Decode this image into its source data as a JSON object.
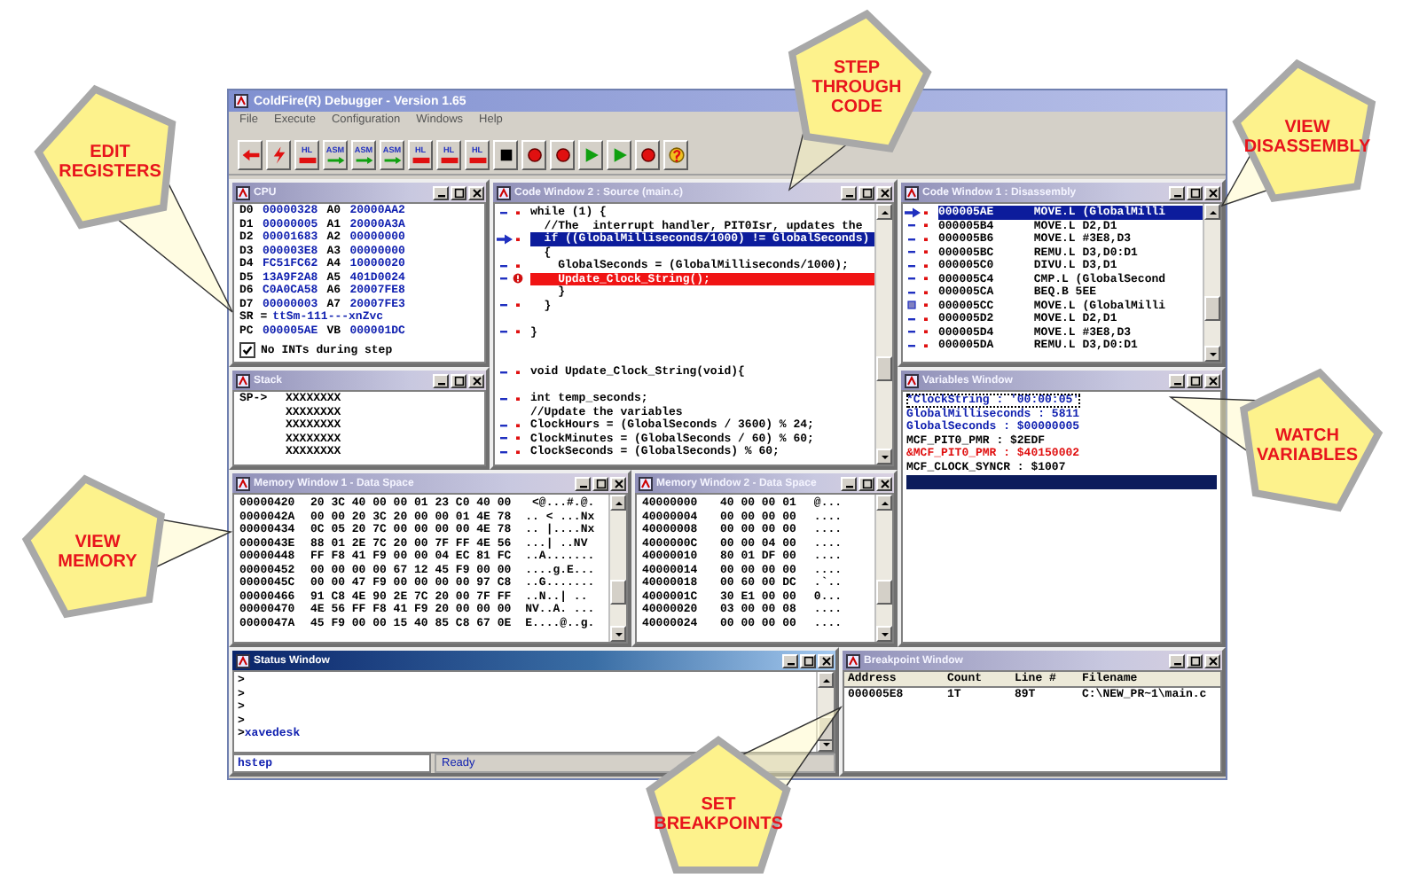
{
  "window": {
    "title": "ColdFire(R) Debugger - Version 1.65"
  },
  "menu": [
    "File",
    "Execute",
    "Configuration",
    "Windows",
    "Help"
  ],
  "toolbar": [
    {
      "kind": "back"
    },
    {
      "kind": "go"
    },
    {
      "kind": "hl",
      "label": "HL"
    },
    {
      "kind": "asm",
      "label": "ASM"
    },
    {
      "kind": "asm",
      "label": "ASM"
    },
    {
      "kind": "asm",
      "label": "ASM"
    },
    {
      "kind": "hl",
      "label": "HL"
    },
    {
      "kind": "hl",
      "label": "HL"
    },
    {
      "kind": "hl",
      "label": "HL"
    },
    {
      "kind": "stop"
    },
    {
      "kind": "breakpoint"
    },
    {
      "kind": "breakpoint"
    },
    {
      "kind": "step"
    },
    {
      "kind": "step"
    },
    {
      "kind": "breakpoint"
    },
    {
      "kind": "help"
    }
  ],
  "cpu_window": {
    "title": "CPU",
    "active": false,
    "rows": [
      [
        {
          "name": "D0",
          "value": "00000328"
        },
        {
          "name": "A0",
          "value": "20000AA2"
        }
      ],
      [
        {
          "name": "D1",
          "value": "00000005"
        },
        {
          "name": "A1",
          "value": "20000A3A"
        }
      ],
      [
        {
          "name": "D2",
          "value": "00001683"
        },
        {
          "name": "A2",
          "value": "00000000"
        }
      ],
      [
        {
          "name": "D3",
          "value": "000003E8"
        },
        {
          "name": "A3",
          "value": "00000000"
        }
      ],
      [
        {
          "name": "D4",
          "value": "FC51FC62"
        },
        {
          "name": "A4",
          "value": "10000020"
        }
      ],
      [
        {
          "name": "D5",
          "value": "13A9F2A8"
        },
        {
          "name": "A5",
          "value": "401D0024"
        }
      ],
      [
        {
          "name": "D6",
          "value": "C0A0CA58"
        },
        {
          "name": "A6",
          "value": "20007FE8"
        }
      ],
      [
        {
          "name": "D7",
          "value": "00000003"
        },
        {
          "name": "A7",
          "value": "20007FE3"
        }
      ],
      [
        {
          "name": "SR =",
          "value": "ttSm-111---xnZvc"
        }
      ],
      [
        {
          "name": "PC",
          "value": "000005AE"
        },
        {
          "name": "VB",
          "value": "000001DC"
        }
      ]
    ],
    "option": {
      "label": "No INTs during step",
      "checked": true
    }
  },
  "stack_window": {
    "title": "Stack",
    "active": false,
    "lines": [
      {
        "label": "SP->",
        "value": "XXXXXXXX"
      },
      {
        "value": "XXXXXXXX"
      },
      {
        "value": "XXXXXXXX"
      },
      {
        "value": "XXXXXXXX"
      },
      {
        "value": "XXXXXXXX"
      }
    ]
  },
  "code_window": {
    "title": "Code Window 2 : Source (main.c)",
    "active": false,
    "lines": [
      {
        "kind": "code",
        "text": "while (1) {"
      },
      {
        "kind": "plain",
        "text": "  //The  interrupt handler, PIT0Isr, updates the"
      },
      {
        "kind": "current",
        "text": "  if ((GlobalMilliseconds/1000) != GlobalSeconds)"
      },
      {
        "kind": "plain",
        "text": "  {"
      },
      {
        "kind": "code",
        "text": "    GlobalSeconds = (GlobalMilliseconds/1000);"
      },
      {
        "kind": "breakpoint",
        "text": "    Update_Clock_String();"
      },
      {
        "kind": "plain",
        "text": "    }"
      },
      {
        "kind": "code",
        "text": "  }"
      },
      {
        "kind": "blank"
      },
      {
        "kind": "code",
        "text": "}"
      },
      {
        "kind": "blank"
      },
      {
        "kind": "blank"
      },
      {
        "kind": "code",
        "text": "void Update_Clock_String(void){"
      },
      {
        "kind": "blank"
      },
      {
        "kind": "code",
        "text": "int temp_seconds;"
      },
      {
        "kind": "plain",
        "text": "//Update the variables"
      },
      {
        "kind": "code",
        "text": "ClockHours = (GlobalSeconds / 3600) % 24;"
      },
      {
        "kind": "code",
        "text": "ClockMinutes = (GlobalSeconds / 60) % 60;"
      },
      {
        "kind": "code",
        "text": "ClockSeconds = (GlobalSeconds) % 60;"
      }
    ]
  },
  "disassembly_window": {
    "title": "Code Window 1 : Disassembly",
    "active": false,
    "rows": [
      {
        "kind": "current",
        "address": "000005AE",
        "instruction": "MOVE.L (GlobalMilli"
      },
      {
        "kind": "code",
        "address": "000005B4",
        "instruction": "MOVE.L D2,D1"
      },
      {
        "kind": "code",
        "address": "000005B6",
        "instruction": "MOVE.L #3E8,D3"
      },
      {
        "kind": "code",
        "address": "000005BC",
        "instruction": "REMU.L D3,D0:D1"
      },
      {
        "kind": "code",
        "address": "000005C0",
        "instruction": "DIVU.L D3,D1"
      },
      {
        "kind": "code",
        "address": "000005C4",
        "instruction": "CMP.L (GlobalSecond"
      },
      {
        "kind": "code",
        "address": "000005CA",
        "instruction": "BEQ.B 5EE"
      },
      {
        "kind": "marked",
        "address": "000005CC",
        "instruction": "MOVE.L (GlobalMilli"
      },
      {
        "kind": "code",
        "address": "000005D2",
        "instruction": "MOVE.L D2,D1"
      },
      {
        "kind": "code",
        "address": "000005D4",
        "instruction": "MOVE.L #3E8,D3"
      },
      {
        "kind": "code",
        "address": "000005DA",
        "instruction": "REMU.L D3,D0:D1"
      }
    ]
  },
  "variables_window": {
    "title": "Variables Window",
    "active": false,
    "rows": [
      {
        "kind": "watch",
        "text": "*ClockString : '00:00:05'"
      },
      {
        "kind": "watch",
        "text": "GlobalMilliseconds : 5811"
      },
      {
        "kind": "watch",
        "text": "GlobalSeconds : $00000005"
      },
      {
        "kind": "plain",
        "text": "MCF_PIT0_PMR : $2EDF"
      },
      {
        "kind": "changed",
        "text": "&MCF_PIT0_PMR : $40150002"
      },
      {
        "kind": "plain",
        "text": "MCF_CLOCK_SYNCR : $1007"
      }
    ]
  },
  "memory_window_1": {
    "title": "Memory Window 1 - Data Space",
    "active": false,
    "rows": [
      {
        "address": "00000420",
        "bytes": "20 3C 40 00 00 01 23 C0 40 00",
        "ascii": " <@...#.@."
      },
      {
        "address": "0000042A",
        "bytes": "00 00 20 3C 20 00 00 01 4E 78",
        "ascii": ".. < ...Nx"
      },
      {
        "address": "00000434",
        "bytes": "0C 05 20 7C 00 00 00 00 4E 78",
        "ascii": ".. |....Nx"
      },
      {
        "address": "0000043E",
        "bytes": "88 01 2E 7C 20 00 7F FF 4E 56",
        "ascii": "...| ..NV"
      },
      {
        "address": "00000448",
        "bytes": "FF F8 41 F9 00 00 04 EC 81 FC",
        "ascii": "..A......."
      },
      {
        "address": "00000452",
        "bytes": "00 00 00 00 67 12 45 F9 00 00",
        "ascii": "....g.E..."
      },
      {
        "address": "0000045C",
        "bytes": "00 00 47 F9 00 00 00 00 97 C8",
        "ascii": "..G......."
      },
      {
        "address": "00000466",
        "bytes": "91 C8 4E 90 2E 7C 20 00 7F FF",
        "ascii": "..N..| .."
      },
      {
        "address": "00000470",
        "bytes": "4E 56 FF F8 41 F9 20 00 00 00",
        "ascii": "NV..A. ..."
      },
      {
        "address": "0000047A",
        "bytes": "45 F9 00 00 15 40 85 C8 67 0E",
        "ascii": "E....@..g."
      }
    ]
  },
  "memory_window_2": {
    "title": "Memory Window 2 - Data Space",
    "active": false,
    "rows": [
      {
        "address": "40000000",
        "bytes": "40 00 00 01",
        "ascii": "@..."
      },
      {
        "address": "40000004",
        "bytes": "00 00 00 00",
        "ascii": "...."
      },
      {
        "address": "40000008",
        "bytes": "00 00 00 00",
        "ascii": "...."
      },
      {
        "address": "4000000C",
        "bytes": "00 00 04 00",
        "ascii": "...."
      },
      {
        "address": "40000010",
        "bytes": "80 01 DF 00",
        "ascii": "...."
      },
      {
        "address": "40000014",
        "bytes": "00 00 00 00",
        "ascii": "...."
      },
      {
        "address": "40000018",
        "bytes": "00 60 00 DC",
        "ascii": ".`.."
      },
      {
        "address": "4000001C",
        "bytes": "30 E1 00 00",
        "ascii": "0..."
      },
      {
        "address": "40000020",
        "bytes": "03 00 00 08",
        "ascii": "...."
      },
      {
        "address": "40000024",
        "bytes": "00 00 00 00",
        "ascii": "...."
      }
    ]
  },
  "status_window": {
    "title": "Status Window",
    "active": true,
    "lines": [
      {
        "prompt": ">"
      },
      {
        "prompt": ">"
      },
      {
        "prompt": ">"
      },
      {
        "prompt": ">"
      },
      {
        "prompt": ">",
        "command": "xavedesk"
      }
    ],
    "command": "hstep",
    "status": "Ready"
  },
  "breakpoint_window": {
    "title": "Breakpoint Window",
    "active": false,
    "columns": [
      "Address",
      "Count",
      "Line #",
      "Filename"
    ],
    "rows": [
      [
        "000005E8",
        "1T",
        "89T",
        "C:\\NEW_PR~1\\main.c"
      ]
    ]
  },
  "callouts": [
    {
      "lines": [
        "EDIT",
        "REGISTERS"
      ]
    },
    {
      "lines": [
        "STEP",
        "THROUGH",
        "CODE"
      ]
    },
    {
      "lines": [
        "VIEW",
        "DISASSEMBLY"
      ]
    },
    {
      "lines": [
        "WATCH",
        "VARIABLES"
      ]
    },
    {
      "lines": [
        "VIEW",
        "MEMORY"
      ]
    },
    {
      "lines": [
        "SET",
        "BREAKPOINTS"
      ]
    }
  ]
}
